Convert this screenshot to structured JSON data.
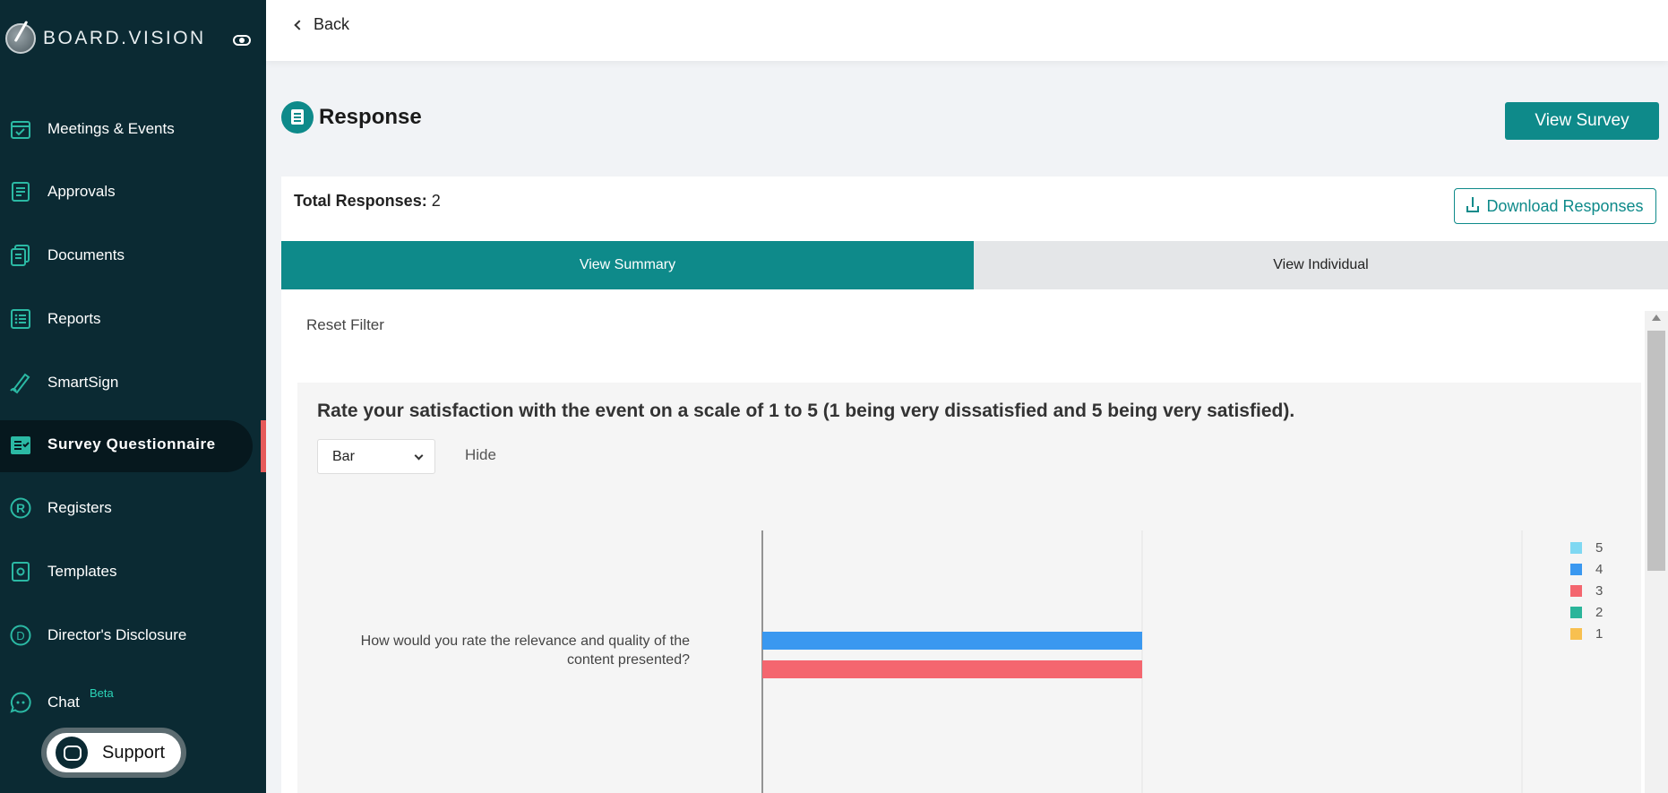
{
  "sidebar": {
    "brand": "BOARD.VISION",
    "items": [
      {
        "label": "Meetings & Events",
        "icon": "calendar-icon"
      },
      {
        "label": "Approvals",
        "icon": "approvals-icon"
      },
      {
        "label": "Documents",
        "icon": "documents-icon"
      },
      {
        "label": "Reports",
        "icon": "reports-icon"
      },
      {
        "label": "SmartSign",
        "icon": "pen-icon"
      },
      {
        "label": "Survey Questionnaire",
        "icon": "survey-icon",
        "active": true
      },
      {
        "label": "Registers",
        "icon": "registered-icon"
      },
      {
        "label": "Templates",
        "icon": "templates-icon"
      },
      {
        "label": "Director's Disclosure",
        "icon": "disclosure-icon"
      },
      {
        "label": "Chat",
        "icon": "chat-icon",
        "badge": "Beta"
      }
    ],
    "support_label": "Support"
  },
  "topbar": {
    "back_label": "Back"
  },
  "header": {
    "title": "Response",
    "view_survey_label": "View Survey"
  },
  "summary": {
    "total_label": "Total Responses:",
    "total_value": "2",
    "download_label": "Download Responses"
  },
  "tabs": {
    "summary": "View Summary",
    "individual": "View Individual"
  },
  "filters": {
    "reset_label": "Reset Filter"
  },
  "question": {
    "text": "Rate your satisfaction with the event on a scale of 1 to 5 (1 being very dissatisfied and 5 being very satisfied).",
    "chart_type_selected": "Bar",
    "hide_label": "Hide"
  },
  "colors": {
    "teal": "#0e8a8a",
    "sidebar_bg": "#0b2a33",
    "series_5": "#7fd8f2",
    "series_4": "#3a98f0",
    "series_3": "#f4666f",
    "series_2": "#2bb59a",
    "series_1": "#f8c050"
  },
  "chart_data": {
    "type": "bar",
    "orientation": "horizontal",
    "categories": [
      "How would you rate the relevance and quality of the content presented?"
    ],
    "series": [
      {
        "name": "5",
        "values": [
          0
        ]
      },
      {
        "name": "4",
        "values": [
          1
        ]
      },
      {
        "name": "3",
        "values": [
          1
        ]
      },
      {
        "name": "2",
        "values": [
          0
        ]
      },
      {
        "name": "1",
        "values": [
          0
        ]
      }
    ],
    "xlim": [
      0,
      2
    ],
    "grid": true,
    "legend_position": "top-right"
  }
}
